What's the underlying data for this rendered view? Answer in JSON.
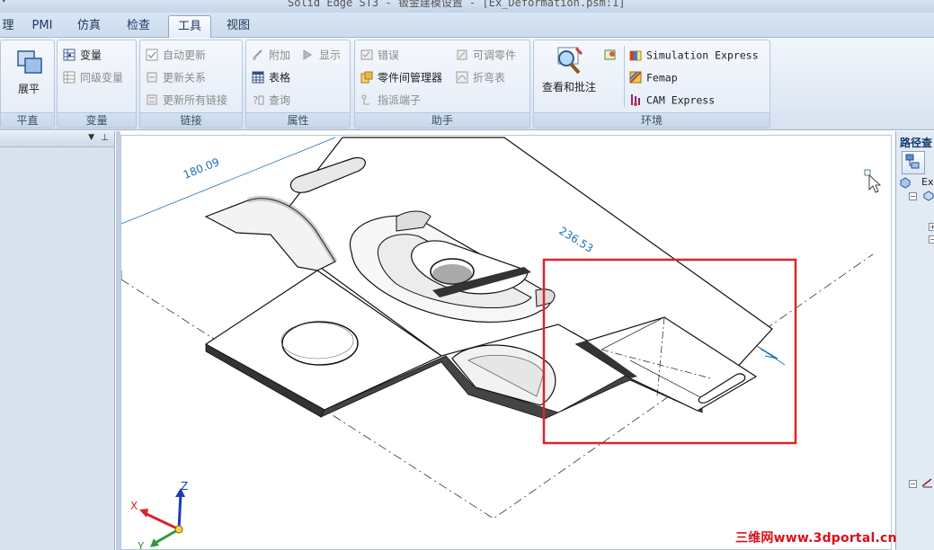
{
  "window": {
    "title": "Solid Edge ST3 - 钣金建模设置 - [Ex_Deformation.psm:1]"
  },
  "tabs": [
    {
      "label": "理",
      "active": false
    },
    {
      "label": "PMI",
      "active": false
    },
    {
      "label": "仿真",
      "active": false
    },
    {
      "label": "检查",
      "active": false
    },
    {
      "label": "工具",
      "active": true
    },
    {
      "label": "视图",
      "active": false
    }
  ],
  "ribbon": {
    "pingzhi": {
      "label": "平直",
      "unfold": "展平"
    },
    "bianliang": {
      "label": "变量",
      "variables": "变量",
      "peer_variables": "同级变量"
    },
    "lianjie": {
      "label": "链接",
      "auto_update": "自动更新",
      "update_relations": "更新关系",
      "update_all_links": "更新所有链接"
    },
    "shuxing": {
      "label": "属性",
      "attach": "附加",
      "show": "显示",
      "table": "表格",
      "query": "查询"
    },
    "zhushou": {
      "label": "助手",
      "errors": "错误",
      "adjustable_part": "可调零件",
      "part_manager": "零件间管理器",
      "bend_table": "折弯表",
      "assign_terminal": "指派端子"
    },
    "huanjing": {
      "label": "环境",
      "review": "查看和批注",
      "simulation": "Simulation Express",
      "femap": "Femap",
      "cam": "CAM Express"
    }
  },
  "viewport": {
    "dimension_1": "180.09",
    "dimension_2": "236.53",
    "axis_x": "X",
    "axis_y": "Y",
    "axis_z": "Z"
  },
  "pathfinder": {
    "title": "路径查",
    "root": "Ex"
  },
  "watermark": "三维网www.3dportal.cn",
  "colors": {
    "accent_red": "#d6262b",
    "dimension_blue": "#1a6fb3",
    "ribbon_bg": "#dfe8f4"
  }
}
